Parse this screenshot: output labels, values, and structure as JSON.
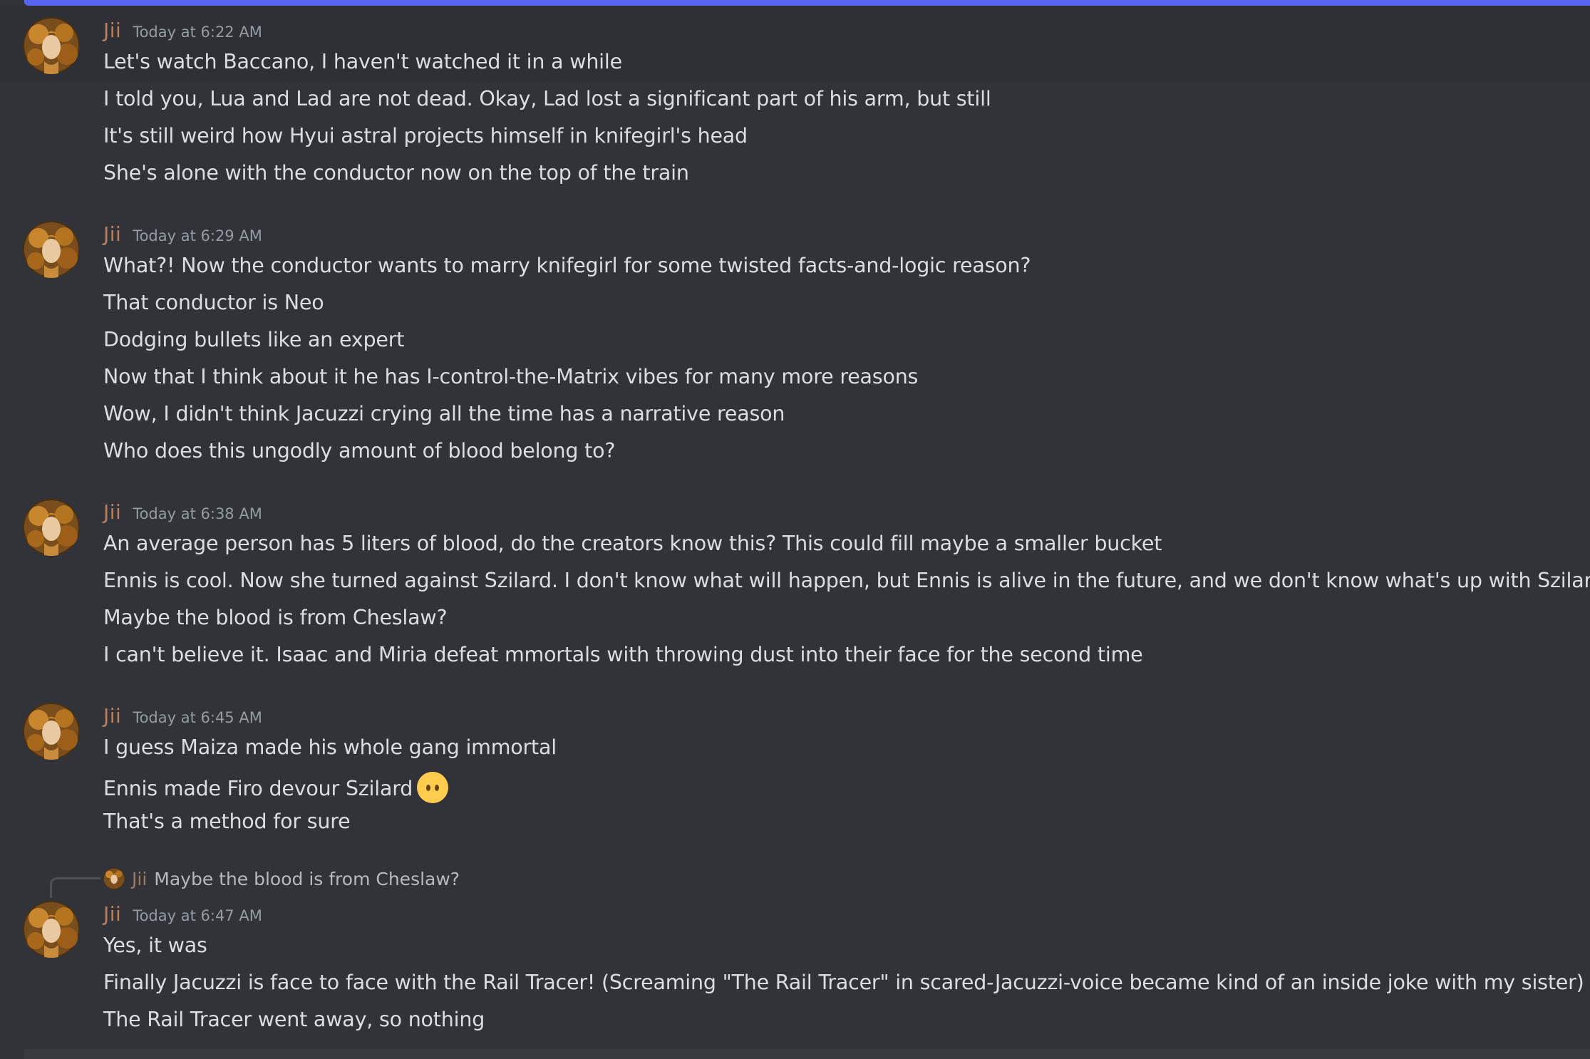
{
  "accent_color": "#5865f2",
  "background_color": "#313338",
  "username_color": "#b8805f",
  "groups": [
    {
      "author": "Jii",
      "timestamp": "Today at 6:22 AM",
      "messages": [
        "Let's watch Baccano, I haven't watched it in a while",
        "I told you, Lua and Lad are not dead. Okay, Lad lost a significant part of his arm, but still",
        "It's still weird how Hyui astral projects himself in knifegirl's head",
        "She's alone with the conductor now on the top of the train"
      ]
    },
    {
      "author": "Jii",
      "timestamp": "Today at 6:29 AM",
      "messages": [
        "What?! Now the conductor wants to marry knifegirl for some twisted facts-and-logic reason?",
        "That conductor is Neo",
        "Dodging bullets like an expert",
        "Now that I think about it he has I-control-the-Matrix vibes for many more reasons",
        "Wow, I didn't think Jacuzzi crying all the time has a narrative reason",
        "Who does this ungodly amount of blood belong to?"
      ]
    },
    {
      "author": "Jii",
      "timestamp": "Today at 6:38 AM",
      "messages": [
        "An average person has 5 liters of blood, do the creators know this? This could fill maybe a smaller bucket",
        "Ennis is cool. Now she turned against Szilard. I don't know what will happen, but Ennis is alive in the future, and we don't know what's up with Szilard",
        "Maybe the blood is from Cheslaw?",
        "I can't believe it. Isaac and Miria defeat mmortals with throwing dust into their face for the second time"
      ]
    },
    {
      "author": "Jii",
      "timestamp": "Today at 6:45 AM",
      "messages": [
        "I guess Maiza made his whole gang immortal",
        "Ennis made Firo devour Szilard",
        "That's a method for sure"
      ],
      "emoji_after_line_2": "neutral-face-emoji"
    },
    {
      "reply_to": {
        "author": "Jii",
        "text": "Maybe the blood is from Cheslaw?"
      },
      "author": "Jii",
      "timestamp": "Today at 6:47 AM",
      "messages": [
        "Yes, it was",
        "Finally Jacuzzi is face to face with the Rail Tracer! (Screaming \"The Rail Tracer\" in scared-Jacuzzi-voice became kind of an inside joke with my sister)",
        "The Rail Tracer went away, so nothing"
      ]
    }
  ]
}
